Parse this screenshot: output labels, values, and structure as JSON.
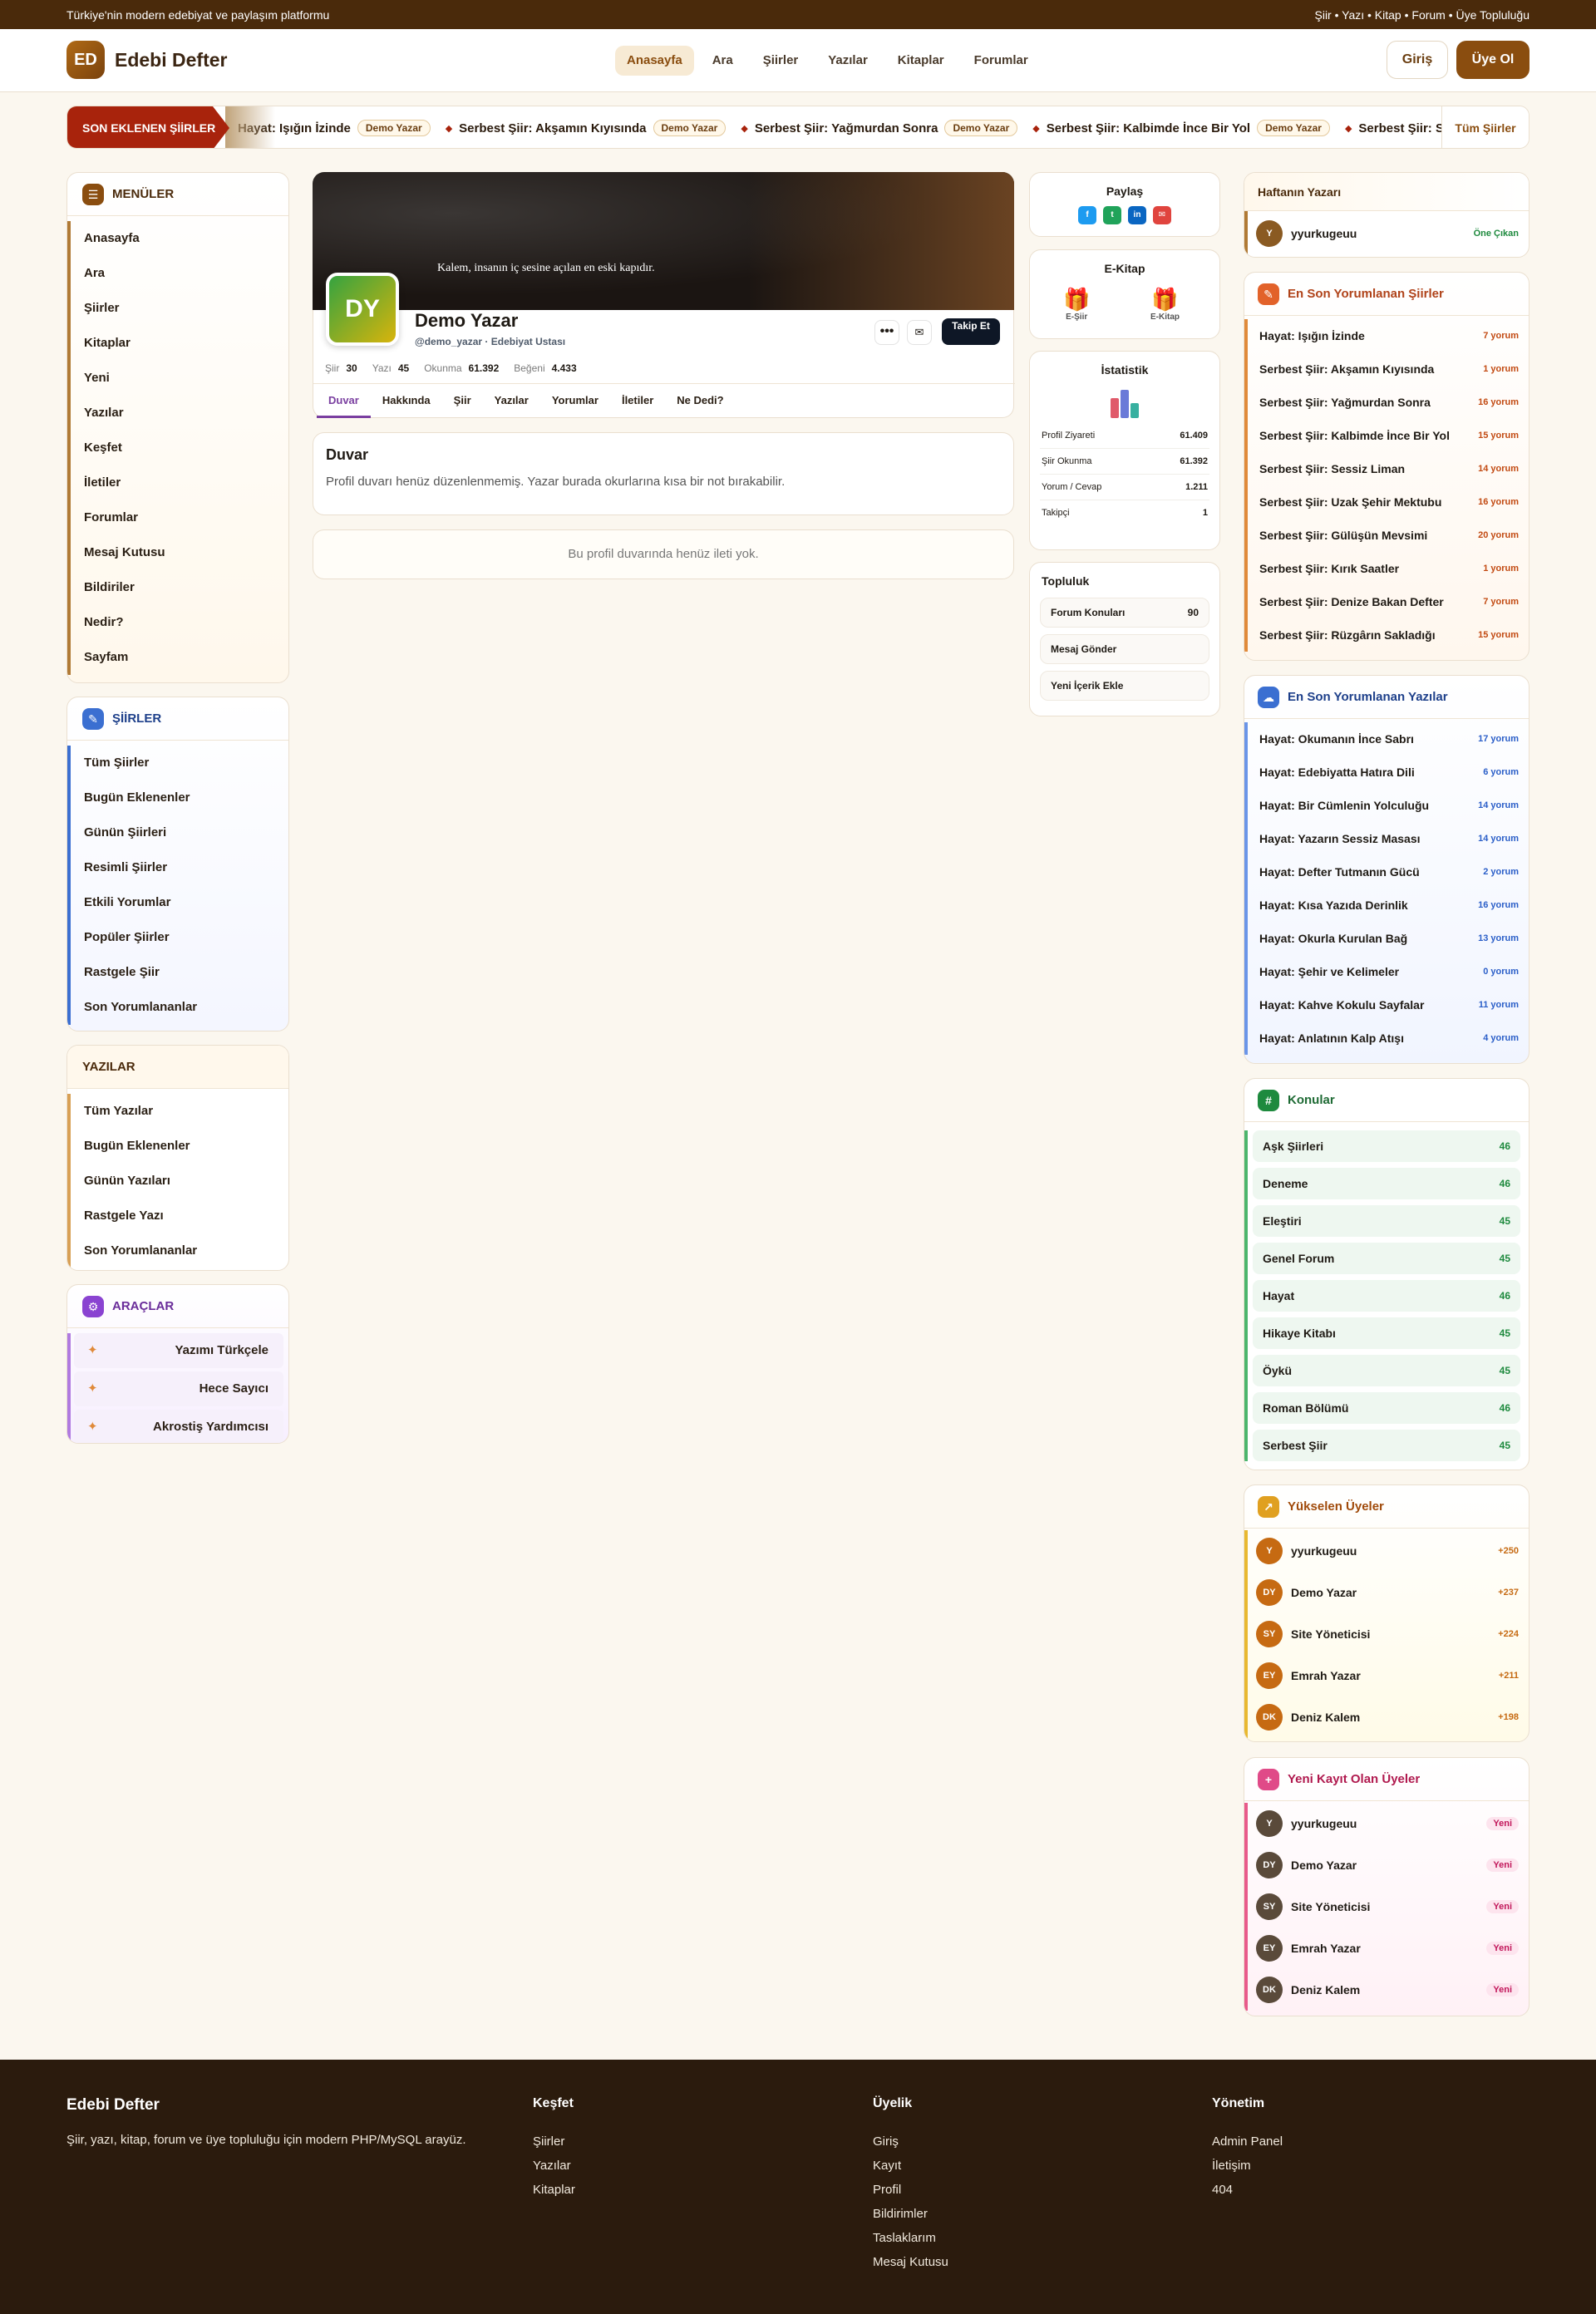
{
  "topbar": {
    "tagline": "Türkiye'nin modern edebiyat ve paylaşım platformu",
    "links": "Şiir • Yazı • Kitap • Forum • Üye Topluluğu"
  },
  "header": {
    "logo_initials": "ED",
    "logo_text": "Edebi Defter",
    "nav": [
      "Anasayfa",
      "Ara",
      "Şiirler",
      "Yazılar",
      "Kitaplar",
      "Forumlar"
    ],
    "login": "Giriş",
    "signup": "Üye Ol"
  },
  "ticker": {
    "label": "SON EKLENEN ŞİİRLER",
    "items": [
      {
        "title": "Hayat: Işığın İzinde",
        "author": "Demo Yazar"
      },
      {
        "title": "Serbest Şiir: Akşamın Kıyısında",
        "author": "Demo Yazar"
      },
      {
        "title": "Serbest Şiir: Yağmurdan Sonra",
        "author": "Demo Yazar"
      },
      {
        "title": "Serbest Şiir: Kalbimde İnce Bir Yol",
        "author": "Demo Yazar"
      },
      {
        "title": "Serbest Şiir: S",
        "author": ""
      }
    ],
    "all_link": "Tüm Şiirler"
  },
  "left": {
    "menus": {
      "title": "MENÜLER",
      "items": [
        "Anasayfa",
        "Ara",
        "Şiirler",
        "Kitaplar",
        "Yeni",
        "Yazılar",
        "Keşfet",
        "İletiler",
        "Forumlar",
        "Mesaj Kutusu",
        "Bildiriler",
        "Nedir?",
        "Sayfam"
      ]
    },
    "poems": {
      "title": "ŞİİRLER",
      "items": [
        "Tüm Şiirler",
        "Bugün Eklenenler",
        "Günün Şiirleri",
        "Resimli Şiirler",
        "Etkili Yorumlar",
        "Popüler Şiirler",
        "Rastgele Şiir",
        "Son Yorumlananlar"
      ]
    },
    "writings": {
      "title": "YAZILAR",
      "items": [
        "Tüm Yazılar",
        "Bugün Eklenenler",
        "Günün Yazıları",
        "Rastgele Yazı",
        "Son Yorumlananlar"
      ]
    },
    "tools": {
      "title": "ARAÇLAR",
      "items": [
        "Yazımı Türkçele",
        "Hece Sayıcı",
        "Akrostiş Yardımcısı"
      ]
    }
  },
  "profile": {
    "quote": "Kalem, insanın iç sesine açılan en eski kapıdır.",
    "initials": "DY",
    "name": "Demo Yazar",
    "handle": "@demo_yazar · Edebiyat Ustası",
    "more": "•••",
    "follow": "Takip Et",
    "stats": [
      {
        "label": "Şiir",
        "value": "30"
      },
      {
        "label": "Yazı",
        "value": "45"
      },
      {
        "label": "Okunma",
        "value": "61.392"
      },
      {
        "label": "Beğeni",
        "value": "4.433"
      }
    ],
    "tabs": [
      "Duvar",
      "Hakkında",
      "Şiir",
      "Yazılar",
      "Yorumlar",
      "İletiler",
      "Ne Dedi?"
    ],
    "wall_title": "Duvar",
    "wall_text": "Profil duvarı henüz düzenlenmemiş. Yazar burada okurlarına kısa bir not bırakabilir.",
    "wall_empty": "Bu profil duvarında henüz ileti yok."
  },
  "mid": {
    "share_title": "Paylaş",
    "share_icons": [
      "f",
      "t",
      "in",
      "✉"
    ],
    "ebook_title": "E-Kitap",
    "ebook_items": [
      "E-Şiir",
      "E-Kitap"
    ],
    "stats_title": "İstatistik",
    "stats": [
      {
        "label": "Profil Ziyareti",
        "value": "61.409"
      },
      {
        "label": "Şiir Okunma",
        "value": "61.392"
      },
      {
        "label": "Yorum / Cevap",
        "value": "1.211"
      },
      {
        "label": "Takipçi",
        "value": "1"
      }
    ],
    "community_title": "Topluluk",
    "community": [
      {
        "label": "Forum Konuları",
        "value": "90"
      },
      {
        "label": "Mesaj Gönder",
        "value": ""
      },
      {
        "label": "Yeni İçerik Ekle",
        "value": ""
      }
    ]
  },
  "right": {
    "week_title": "Haftanın Yazarı",
    "week_author": {
      "initial": "Y",
      "name": "yyurkugeuu",
      "badge": "Öne Çıkan"
    },
    "poems_title": "En Son Yorumlanan Şiirler",
    "poems": [
      {
        "title": "Hayat: Işığın İzinde",
        "count": "7 yorum"
      },
      {
        "title": "Serbest Şiir: Akşamın Kıyısında",
        "count": "1 yorum"
      },
      {
        "title": "Serbest Şiir: Yağmurdan Sonra",
        "count": "16 yorum"
      },
      {
        "title": "Serbest Şiir: Kalbimde İnce Bir Yol",
        "count": "15 yorum"
      },
      {
        "title": "Serbest Şiir: Sessiz Liman",
        "count": "14 yorum"
      },
      {
        "title": "Serbest Şiir: Uzak Şehir Mektubu",
        "count": "16 yorum"
      },
      {
        "title": "Serbest Şiir: Gülüşün Mevsimi",
        "count": "20 yorum"
      },
      {
        "title": "Serbest Şiir: Kırık Saatler",
        "count": "1 yorum"
      },
      {
        "title": "Serbest Şiir: Denize Bakan Defter",
        "count": "7 yorum"
      },
      {
        "title": "Serbest Şiir: Rüzgârın Sakladığı",
        "count": "15 yorum"
      }
    ],
    "writings_title": "En Son Yorumlanan Yazılar",
    "writings": [
      {
        "title": "Hayat: Okumanın İnce Sabrı",
        "count": "17 yorum"
      },
      {
        "title": "Hayat: Edebiyatta Hatıra Dili",
        "count": "6 yorum"
      },
      {
        "title": "Hayat: Bir Cümlenin Yolculuğu",
        "count": "14 yorum"
      },
      {
        "title": "Hayat: Yazarın Sessiz Masası",
        "count": "14 yorum"
      },
      {
        "title": "Hayat: Defter Tutmanın Gücü",
        "count": "2 yorum"
      },
      {
        "title": "Hayat: Kısa Yazıda Derinlik",
        "count": "16 yorum"
      },
      {
        "title": "Hayat: Okurla Kurulan Bağ",
        "count": "13 yorum"
      },
      {
        "title": "Hayat: Şehir ve Kelimeler",
        "count": "0 yorum"
      },
      {
        "title": "Hayat: Kahve Kokulu Sayfalar",
        "count": "11 yorum"
      },
      {
        "title": "Hayat: Anlatının Kalp Atışı",
        "count": "4 yorum"
      }
    ],
    "topics_title": "Konular",
    "topics": [
      {
        "name": "Aşk Şiirleri",
        "count": "46"
      },
      {
        "name": "Deneme",
        "count": "46"
      },
      {
        "name": "Eleştiri",
        "count": "45"
      },
      {
        "name": "Genel Forum",
        "count": "45"
      },
      {
        "name": "Hayat",
        "count": "46"
      },
      {
        "name": "Hikaye Kitabı",
        "count": "45"
      },
      {
        "name": "Öykü",
        "count": "45"
      },
      {
        "name": "Roman Bölümü",
        "count": "46"
      },
      {
        "name": "Serbest Şiir",
        "count": "45"
      }
    ],
    "rising_title": "Yükselen Üyeler",
    "rising": [
      {
        "initials": "Y",
        "name": "yyurkugeuu",
        "score": "+250"
      },
      {
        "initials": "DY",
        "name": "Demo Yazar",
        "score": "+237"
      },
      {
        "initials": "SY",
        "name": "Site Yöneticisi",
        "score": "+224"
      },
      {
        "initials": "EY",
        "name": "Emrah Yazar",
        "score": "+211"
      },
      {
        "initials": "DK",
        "name": "Deniz Kalem",
        "score": "+198"
      }
    ],
    "new_title": "Yeni Kayıt Olan Üyeler",
    "new_members": [
      {
        "initials": "Y",
        "name": "yyurkugeuu",
        "badge": "Yeni"
      },
      {
        "initials": "DY",
        "name": "Demo Yazar",
        "badge": "Yeni"
      },
      {
        "initials": "SY",
        "name": "Site Yöneticisi",
        "badge": "Yeni"
      },
      {
        "initials": "EY",
        "name": "Emrah Yazar",
        "badge": "Yeni"
      },
      {
        "initials": "DK",
        "name": "Deniz Kalem",
        "badge": "Yeni"
      }
    ]
  },
  "footer": {
    "brand": "Edebi Defter",
    "desc": "Şiir, yazı, kitap, forum ve üye topluluğu için modern PHP/MySQL arayüz.",
    "explore": {
      "title": "Keşfet",
      "links": [
        "Şiirler",
        "Yazılar",
        "Kitaplar"
      ]
    },
    "membership": {
      "title": "Üyelik",
      "links": [
        "Giriş",
        "Kayıt",
        "Profil",
        "Bildirimler",
        "Taslaklarım",
        "Mesaj Kutusu"
      ]
    },
    "admin": {
      "title": "Yönetim",
      "links": [
        "Admin Panel",
        "İletişim",
        "404"
      ]
    }
  },
  "colors": {
    "brand": "#8a4d0f",
    "ticker_red": "#a8230c",
    "footer_bg": "#2b1b0d",
    "poem_accent": "#e08a3a",
    "writing_accent": "#3b6fd1",
    "topic_accent": "#1e8a3e"
  }
}
